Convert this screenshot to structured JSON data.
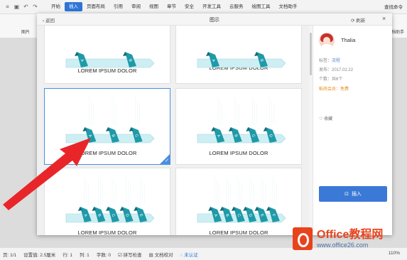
{
  "app": {
    "menu": [
      "开始",
      "插入",
      "页面布局",
      "引用",
      "审阅",
      "视图",
      "章节",
      "安全",
      "开发工具",
      "云服务",
      "绘图工具",
      "文档助手"
    ],
    "active_menu": "插入",
    "search_cmd": "查找命令",
    "ribbon_left": "图片",
    "ribbon_right": "文档助手"
  },
  "dialog": {
    "back": "返回",
    "title": "图示",
    "refresh": "刷新",
    "close": "×"
  },
  "templates": [
    {
      "label": "LOREM IPSUM DOLOR",
      "tabs": 2,
      "selected": false
    },
    {
      "label": "LOREM IPSUM DOLOR",
      "tabs": 2,
      "selected": false
    },
    {
      "label": "LOREM IPSUM DOLOR",
      "tabs": 3,
      "letters": [
        "A",
        "B",
        "C"
      ],
      "selected": true
    },
    {
      "label": "LOREM IPSUM DOLOR",
      "tabs": 4,
      "letters": [
        "A",
        "B",
        "C",
        "D"
      ],
      "selected": false
    },
    {
      "label": "LOREM IPSUM DOLOR",
      "tabs": 5,
      "letters": [
        "A",
        "B",
        "C",
        "D",
        "E"
      ],
      "selected": false
    },
    {
      "label": "LOREM IPSUM DOLOR",
      "tabs": 6,
      "letters": [
        "A",
        "B",
        "C",
        "D",
        "E",
        "F"
      ],
      "selected": false
    }
  ],
  "panel": {
    "author": "Thalia",
    "tag_label": "标签：",
    "tag_value": "流程",
    "date_label": "发布：",
    "date_value": "2017.02.22",
    "count_label": "个数：",
    "count_value": "共6个",
    "vip_label": "稻壳会员：",
    "vip_value": "免费",
    "favorite": "收藏",
    "insert": "插入"
  },
  "status": {
    "page": "页: 1/1",
    "setting": "设置值: 2.5厘米",
    "row": "行: 1",
    "col": "列: 1",
    "chars": "字数: 0",
    "spell": "拼写检查",
    "check": "文档校对",
    "unauth": "未认证",
    "zoom": "110%"
  },
  "watermark": {
    "title": "Office教程网",
    "url": "www.office26.com"
  },
  "colors": {
    "accent": "#2f75d6",
    "teal": "#1f9aa8",
    "band": "#cdeff4",
    "arrow": "#e8262a"
  }
}
